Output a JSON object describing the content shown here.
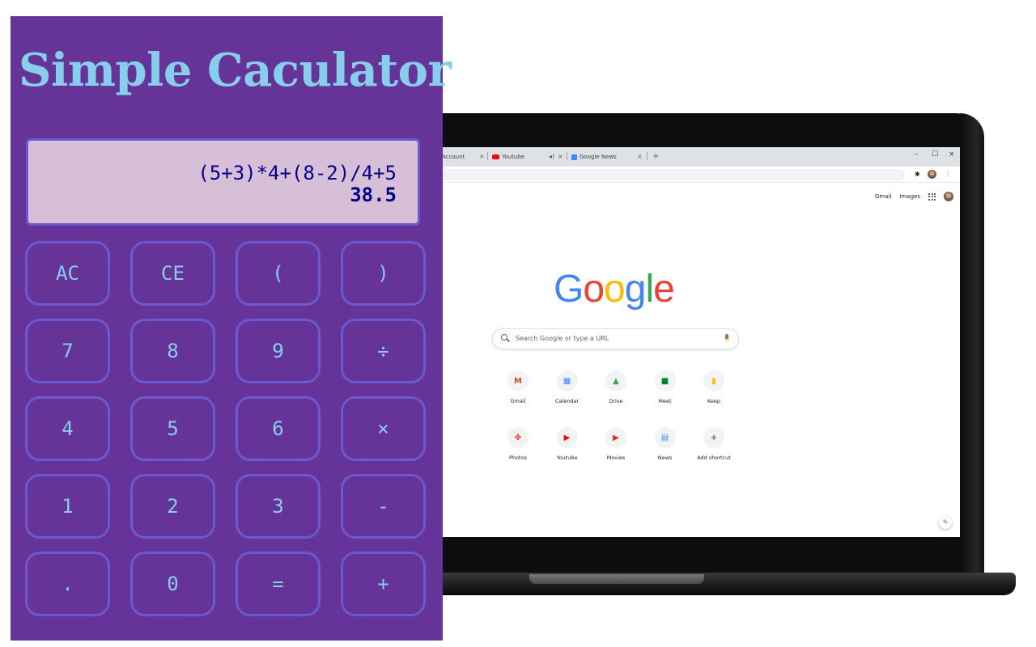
{
  "calculator": {
    "title": "Simple Caculator",
    "display": {
      "expression": "(5+3)*4+(8-2)/4+5",
      "result": "38.5"
    },
    "keys": [
      [
        "AC",
        "CE",
        "(",
        ")"
      ],
      [
        "7",
        "8",
        "9",
        "÷"
      ],
      [
        "4",
        "5",
        "6",
        "×"
      ],
      [
        "1",
        "2",
        "3",
        "-"
      ],
      [
        ".",
        "0",
        "=",
        "+"
      ]
    ],
    "colors": {
      "background": "#663399",
      "title": "#87ceeb",
      "display_bg": "#d8bfd8",
      "display_text": "#00008b",
      "key_border": "#6a5acd",
      "key_text": "#87ceeb"
    }
  },
  "browser": {
    "tabs": [
      {
        "label": "Account",
        "icon": "none"
      },
      {
        "label": "Youtube",
        "icon": "youtube-icon"
      },
      {
        "label": "Google News",
        "icon": "news-icon"
      }
    ],
    "top_links": {
      "gmail": "Gmail",
      "images": "Images"
    },
    "logo": [
      "G",
      "o",
      "o",
      "g",
      "l",
      "e"
    ],
    "logo_colors": [
      "#4285f4",
      "#ea4335",
      "#fbbc05",
      "#4285f4",
      "#34a853",
      "#ea4335"
    ],
    "search_placeholder": "Search Google or type a URL",
    "shortcuts": [
      {
        "label": "Gmail",
        "icon": "gmail-icon"
      },
      {
        "label": "Calendar",
        "icon": "calendar-icon"
      },
      {
        "label": "Drive",
        "icon": "drive-icon"
      },
      {
        "label": "Meet",
        "icon": "meet-icon"
      },
      {
        "label": "Keep",
        "icon": "keep-icon"
      },
      {
        "label": "Photos",
        "icon": "photos-icon"
      },
      {
        "label": "Youtube",
        "icon": "youtube-icon"
      },
      {
        "label": "Movies",
        "icon": "movies-icon"
      },
      {
        "label": "News",
        "icon": "news-icon"
      },
      {
        "label": "Add shortcut",
        "icon": "plus-icon"
      }
    ]
  }
}
